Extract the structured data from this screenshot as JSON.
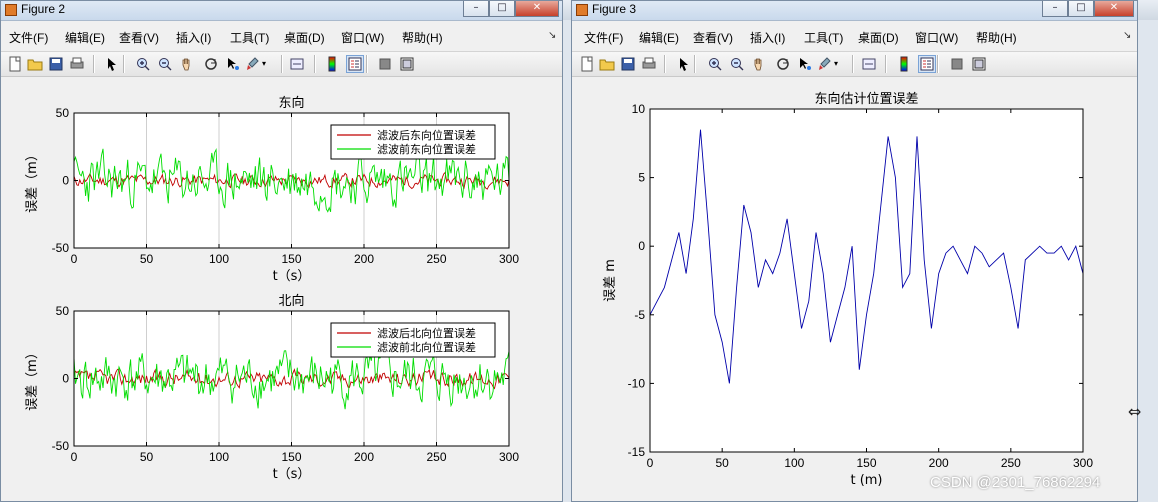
{
  "windows": [
    {
      "title": "Figure 2",
      "menu": [
        "文件(F)",
        "编辑(E)",
        "查看(V)",
        "插入(I)",
        "工具(T)",
        "桌面(D)",
        "窗口(W)",
        "帮助(H)"
      ],
      "menu_arrow": "↘"
    },
    {
      "title": "Figure 3",
      "menu": [
        "文件(F)",
        "编辑(E)",
        "查看(V)",
        "插入(I)",
        "工具(T)",
        "桌面(D)",
        "窗口(W)",
        "帮助(H)"
      ],
      "menu_arrow": "↘"
    }
  ],
  "toolbar_icons": [
    "new-figure-icon",
    "open-file-icon",
    "save-icon",
    "print-icon",
    "pointer-icon",
    "zoom-in-icon",
    "zoom-out-icon",
    "pan-hand-icon",
    "rotate-3d-icon",
    "data-cursor-icon",
    "brush-icon",
    "link-plot-icon",
    "colorbar-icon",
    "legend-icon",
    "hide-plot-tools-icon",
    "show-plot-tools-icon"
  ],
  "chart_data": [
    {
      "type": "line",
      "title": "东向",
      "xlabel": "t（s）",
      "ylabel": "误差（m）",
      "xlim": [
        0,
        300
      ],
      "ylim": [
        -50,
        50
      ],
      "xticks": [
        0,
        50,
        100,
        150,
        200,
        250,
        300
      ],
      "yticks": [
        -50,
        0,
        50
      ],
      "grid": "vertical",
      "legend_position": "top-right",
      "series": [
        {
          "name": "滤波后东向位置误差",
          "color": "#c00000",
          "amplitude": 4,
          "seed": 11
        },
        {
          "name": "滤波前东向位置误差",
          "color": "#00dd00",
          "amplitude": 16,
          "seed": 23
        }
      ]
    },
    {
      "type": "line",
      "title": "北向",
      "xlabel": "t（s）",
      "ylabel": "误差（m）",
      "xlim": [
        0,
        300
      ],
      "ylim": [
        -50,
        50
      ],
      "xticks": [
        0,
        50,
        100,
        150,
        200,
        250,
        300
      ],
      "yticks": [
        -50,
        0,
        50
      ],
      "grid": "vertical",
      "legend_position": "top-right",
      "series": [
        {
          "name": "滤波后北向位置误差",
          "color": "#c00000",
          "amplitude": 5,
          "seed": 37
        },
        {
          "name": "滤波前北向位置误差",
          "color": "#00dd00",
          "amplitude": 16,
          "seed": 41
        }
      ]
    },
    {
      "type": "line",
      "title": "东向估计位置误差",
      "xlabel": "t (m)",
      "ylabel": "误差 m",
      "xlim": [
        0,
        300
      ],
      "ylim": [
        -15,
        10
      ],
      "xticks": [
        0,
        50,
        100,
        150,
        200,
        250,
        300
      ],
      "yticks": [
        -15,
        -10,
        -5,
        0,
        5,
        10
      ],
      "grid": "none",
      "series": [
        {
          "color": "#0000aa",
          "x": [
            0,
            5,
            10,
            15,
            20,
            25,
            30,
            35,
            40,
            45,
            50,
            55,
            60,
            65,
            70,
            75,
            80,
            85,
            90,
            95,
            100,
            105,
            110,
            115,
            120,
            125,
            130,
            135,
            140,
            145,
            150,
            155,
            160,
            165,
            170,
            175,
            180,
            185,
            190,
            195,
            200,
            205,
            210,
            215,
            220,
            225,
            230,
            235,
            240,
            245,
            250,
            255,
            260,
            265,
            270,
            275,
            280,
            285,
            290,
            295,
            300
          ],
          "y": [
            -5,
            -4,
            -3,
            -1,
            1,
            -2,
            2,
            8.5,
            2,
            -5,
            -7,
            -10,
            -3,
            3,
            1,
            -3,
            -1,
            -2,
            -0.5,
            2,
            -2,
            -6,
            -4,
            1,
            -2,
            -7,
            -5,
            -3,
            0,
            -9,
            -5,
            -2,
            3,
            8,
            5,
            -3,
            -2,
            8,
            -1,
            -6,
            -2,
            -0.5,
            0,
            -1,
            -2,
            0,
            -0.5,
            -1.5,
            -1,
            -0.5,
            -3,
            -6,
            -1,
            -0.5,
            0,
            -0.5,
            -0.5,
            0,
            -1,
            0,
            -2
          ]
        }
      ]
    }
  ],
  "watermark": "CSDN @2301_76862294"
}
